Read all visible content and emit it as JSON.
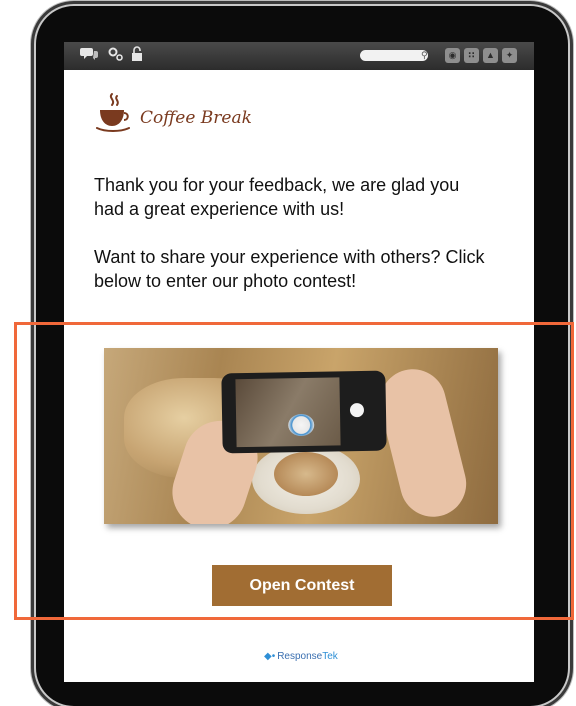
{
  "toolbar": {
    "icons": [
      "chat-icon",
      "settings-icon",
      "lock-icon"
    ],
    "social": [
      "globe-icon",
      "rss-icon",
      "thumbs-up-icon",
      "twitter-icon"
    ],
    "search_placeholder": ""
  },
  "logo": {
    "text": "Coffee Break"
  },
  "message": {
    "line1": "Thank you for your feedback, we are glad you had a great experience with us!",
    "line2": "Want to share your experience with others? Click below to enter our photo contest!"
  },
  "cta": {
    "label": "Open Contest"
  },
  "footer": {
    "brand_main": "Response",
    "brand_accent": "Tek"
  },
  "colors": {
    "accent": "#a16d33",
    "highlight": "#f0683a",
    "logo": "#7a3a1f"
  }
}
